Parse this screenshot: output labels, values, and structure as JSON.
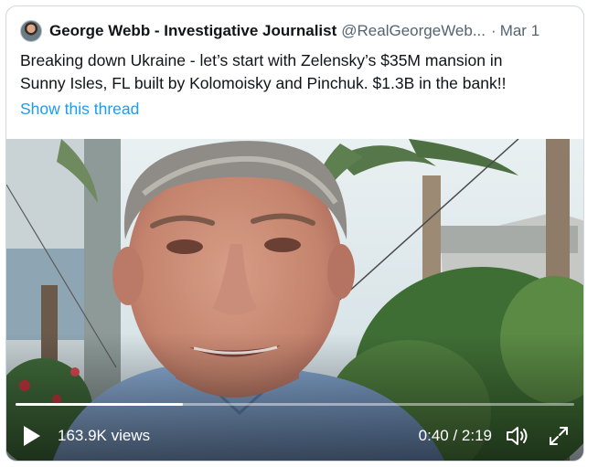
{
  "tweet": {
    "author_name": "George Webb - Investigative Journalist",
    "handle": "@RealGeorgeWeb...",
    "separator": "·",
    "date": "Mar 1",
    "text_lines": [
      "Breaking down Ukraine - let’s start with Zelensky’s $35M mansion in",
      "Sunny Isles, FL built by Kolomoisky and Pinchuk. $1.3B in the bank!!"
    ],
    "show_thread": "Show this thread"
  },
  "video": {
    "views_count": "163.9K",
    "views_label": "views",
    "time": "0:40 / 2:19",
    "progress": 0.3,
    "icons": [
      "play-icon",
      "volume-icon",
      "fullscreen-icon"
    ]
  },
  "colors": {
    "link": "#1d9bf0",
    "secondary_text": "#536471",
    "border": "#cfd9de"
  }
}
